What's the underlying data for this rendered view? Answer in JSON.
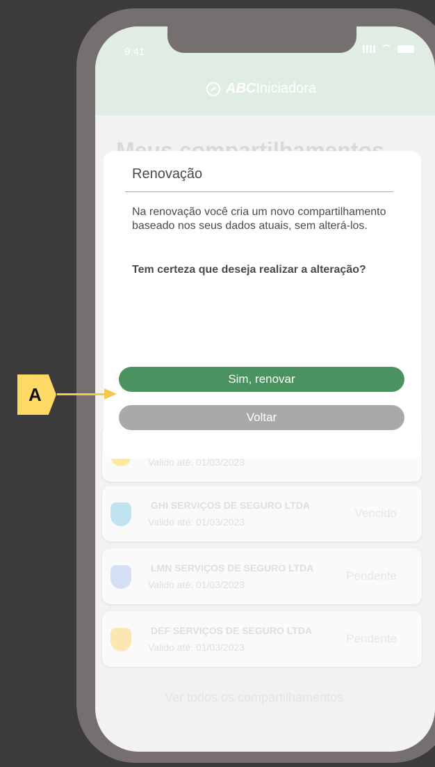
{
  "status_bar": {
    "time": "9:41"
  },
  "header": {
    "brand_strong": "ABC",
    "brand_light": "Iniciadora"
  },
  "page": {
    "title": "Meus compartilhamentos"
  },
  "cards": [
    {
      "name": "",
      "date": "Valido até: 01/03/2023",
      "status": "",
      "icon_color": "#ffe8a0"
    },
    {
      "name": "GHI SERVIÇOS DE SEGURO LTDA",
      "date": "Valido até: 01/03/2023",
      "status": "Vencido",
      "icon_color": "#bfe4ef"
    },
    {
      "name": "LMN SERVIÇOS DE SEGURO LTDA",
      "date": "Valido até: 01/03/2023",
      "status": "Pendente",
      "icon_color": "#d5dff4"
    },
    {
      "name": "DEF SERVIÇOS DE SEGURO LTDA",
      "date": "Valido até: 01/03/2023",
      "status": "Pendente",
      "icon_color": "#fbe7b4"
    }
  ],
  "view_all": "Ver todos os compartilhamentos",
  "modal": {
    "title": "Renovação",
    "body": "Na renovação você cria um novo compartilhamento baseado nos seus dados atuais, sem alterá-los.",
    "question": "Tem certeza que deseja realizar a alteração?",
    "primary_button": "Sim, renovar",
    "secondary_button": "Voltar"
  },
  "annotation": {
    "label": "A"
  }
}
